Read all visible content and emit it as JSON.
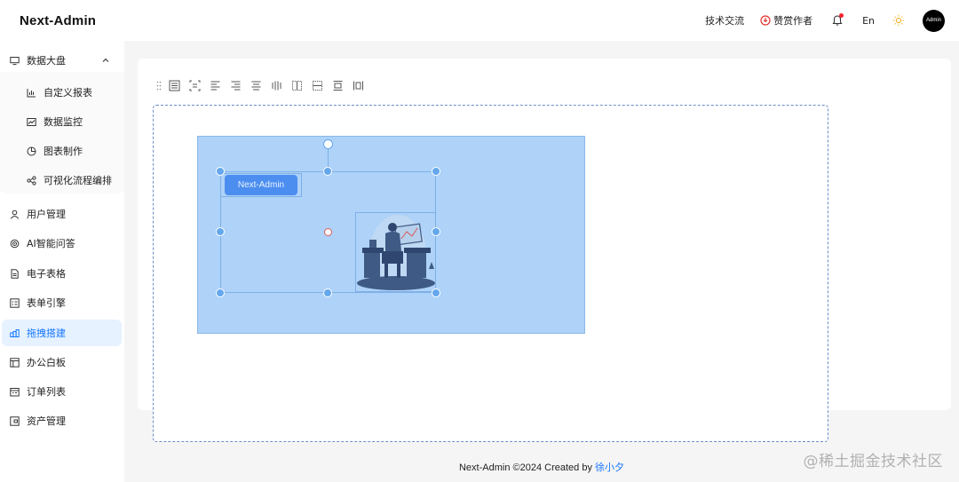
{
  "app": {
    "logo": "Next-Admin"
  },
  "header": {
    "tech_exchange": "技术交流",
    "sponsor": "赞赏作者",
    "language": "En",
    "avatar_text": "Admin"
  },
  "sidebar": {
    "items": [
      {
        "label": "数据大盘",
        "icon": "monitor-icon",
        "expanded": true
      },
      {
        "label": "自定义报表",
        "icon": "bar-chart-icon"
      },
      {
        "label": "数据监控",
        "icon": "line-chart-icon"
      },
      {
        "label": "图表制作",
        "icon": "pie-chart-icon"
      },
      {
        "label": "可视化流程编排",
        "icon": "flow-icon"
      },
      {
        "label": "用户管理",
        "icon": "user-icon"
      },
      {
        "label": "AI智能问答",
        "icon": "ai-icon"
      },
      {
        "label": "电子表格",
        "icon": "file-icon"
      },
      {
        "label": "表单引擎",
        "icon": "form-icon"
      },
      {
        "label": "拖拽搭建",
        "icon": "drag-build-icon",
        "active": true
      },
      {
        "label": "办公白板",
        "icon": "whiteboard-icon"
      },
      {
        "label": "订单列表",
        "icon": "order-icon"
      },
      {
        "label": "资产管理",
        "icon": "asset-icon"
      }
    ]
  },
  "editor": {
    "button_label": "Next-Admin",
    "toolbar_icons": [
      "drag-handle-icon",
      "align-top-icon",
      "align-center-v-icon",
      "align-left-icon",
      "align-right-icon",
      "align-center-h-icon",
      "distribute-h-icon",
      "distribute-grid-icon",
      "distribute-dots-icon",
      "align-bottom-icon",
      "distribute-v-icon"
    ]
  },
  "footer": {
    "text": "Next-Admin ©2024 Created by ",
    "author": "徐小夕"
  },
  "watermark": "@稀土掘金技术社区",
  "colors": {
    "accent": "#1677ff",
    "selection": "#aed2f8",
    "handle": "#64a7ec"
  }
}
